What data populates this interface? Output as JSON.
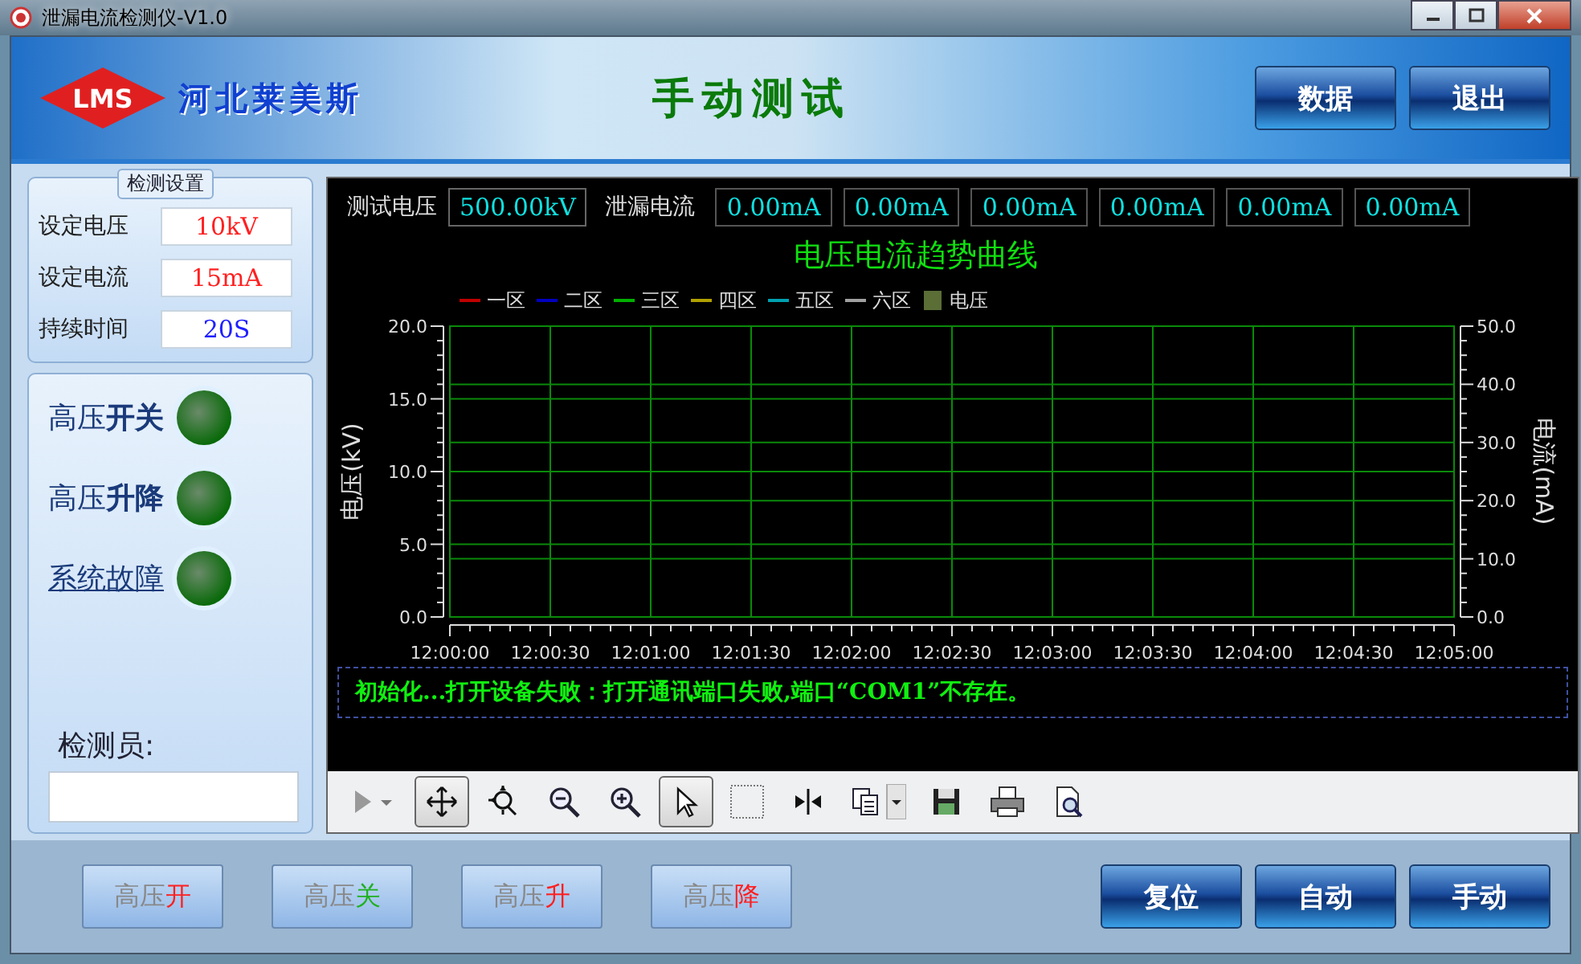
{
  "window": {
    "title": "泄漏电流检测仪-V1.0"
  },
  "header": {
    "logo": "LMS",
    "company": "河北莱美斯",
    "title": "手动测试",
    "buttons": [
      "数据",
      "退出"
    ]
  },
  "settings": {
    "title": "检测设置",
    "fields": [
      {
        "label": "设定电压",
        "value": "10kV",
        "color": "#ff2020"
      },
      {
        "label": "设定电流",
        "value": "15mA",
        "color": "#ff2020"
      },
      {
        "label": "持续时间",
        "value": "20S",
        "color": "#2020ff"
      }
    ]
  },
  "indicators": [
    {
      "kind": "label",
      "label": "高压**开关**",
      "on": false
    },
    {
      "kind": "label",
      "label": "高压**升降**",
      "on": false
    },
    {
      "kind": "link",
      "label": "系统故障",
      "on": false
    }
  ],
  "inspector": {
    "label": "检测员:"
  },
  "readings": {
    "voltage_label": "测试电压",
    "voltage": "500.00kV",
    "current_label": "泄漏电流",
    "currents": [
      "0.00mA",
      "0.00mA",
      "0.00mA",
      "0.00mA",
      "0.00mA",
      "0.00mA"
    ]
  },
  "chart_data": {
    "type": "line",
    "grid": true,
    "title": "电压电流趋势曲线",
    "ylabel": "电压(kV)",
    "y2label": "电流(mA)",
    "x": [
      "12:00:00",
      "12:00:30",
      "12:01:00",
      "12:01:30",
      "12:02:00",
      "12:02:30",
      "12:03:00",
      "12:03:30",
      "12:04:00",
      "12:04:30",
      "12:05:00"
    ],
    "ylim": [
      0,
      20
    ],
    "yticks": [
      {
        "value": 0,
        "label": "0.0"
      },
      {
        "value": 5,
        "label": "5.0"
      },
      {
        "value": 10,
        "label": "10.0"
      },
      {
        "value": 15,
        "label": "15.0"
      },
      {
        "value": 20,
        "label": "20.0"
      }
    ],
    "y2ticks": [
      "0.0",
      "10.0",
      "20.0",
      "30.0",
      "40.0",
      "50.0"
    ],
    "series": [
      {
        "name": "一区",
        "color": "#c00000",
        "values": [
          null,
          null,
          null,
          null,
          null,
          null,
          null,
          null,
          null,
          null,
          null
        ]
      },
      {
        "name": "二区",
        "color": "#0000c0",
        "values": [
          null,
          null,
          null,
          null,
          null,
          null,
          null,
          null,
          null,
          null,
          null
        ]
      },
      {
        "name": "三区",
        "color": "#00b000",
        "values": [
          null,
          null,
          null,
          null,
          null,
          null,
          null,
          null,
          null,
          null,
          null
        ]
      },
      {
        "name": "四区",
        "color": "#b0a000",
        "values": [
          null,
          null,
          null,
          null,
          null,
          null,
          null,
          null,
          null,
          null,
          null
        ]
      },
      {
        "name": "五区",
        "color": "#00a0b0",
        "values": [
          null,
          null,
          null,
          null,
          null,
          null,
          null,
          null,
          null,
          null,
          null
        ]
      },
      {
        "name": "六区",
        "color": "#a0a0a0",
        "values": [
          null,
          null,
          null,
          null,
          null,
          null,
          null,
          null,
          null,
          null,
          null
        ]
      },
      {
        "name": "电压",
        "color": "#5a6e36",
        "values": [
          null,
          null,
          null,
          null,
          null,
          null,
          null,
          null,
          null,
          null,
          null
        ]
      }
    ]
  },
  "status_message": "初始化...打开设备失败：打开通讯端口失败,端口“COM1”不存在。",
  "toolbar": [
    {
      "kind": "play",
      "selected": false
    },
    {
      "kind": "move",
      "selected": true
    },
    {
      "kind": "zoom-fit",
      "selected": false
    },
    {
      "kind": "zoom-out",
      "selected": false
    },
    {
      "kind": "zoom-in",
      "selected": false
    },
    {
      "kind": "pointer",
      "selected": true
    },
    {
      "kind": "select",
      "selected": false
    },
    {
      "kind": "split",
      "selected": false
    },
    {
      "kind": "copy",
      "selected": false
    },
    {
      "kind": "save",
      "selected": false
    },
    {
      "kind": "print",
      "selected": false
    },
    {
      "kind": "preview",
      "selected": false
    }
  ],
  "control_buttons": [
    {
      "label": "高压",
      "accent": "开",
      "color": "#ff2020"
    },
    {
      "label": "高压",
      "accent": "关",
      "color": "#20b020"
    },
    {
      "label": "高压",
      "accent": "升",
      "color": "#ff2020"
    },
    {
      "label": "高压",
      "accent": "降",
      "color": "#ff2020"
    }
  ],
  "mode_buttons": [
    "复位",
    "自动",
    "手动"
  ]
}
